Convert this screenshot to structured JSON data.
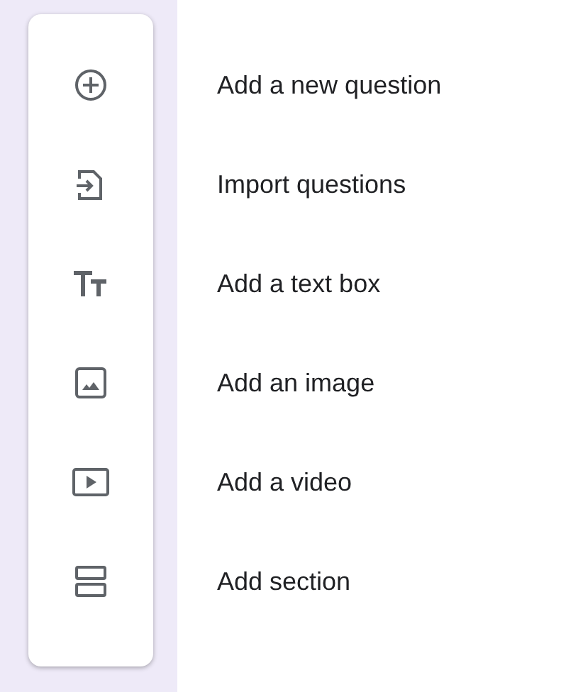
{
  "toolbar": {
    "items": [
      {
        "kind": "add-circle",
        "label": "Add a new question"
      },
      {
        "kind": "import",
        "label": "Import questions"
      },
      {
        "kind": "text",
        "label": "Add a text box"
      },
      {
        "kind": "image",
        "label": "Add an image"
      },
      {
        "kind": "video",
        "label": "Add a video"
      },
      {
        "kind": "section",
        "label": "Add section"
      }
    ]
  }
}
